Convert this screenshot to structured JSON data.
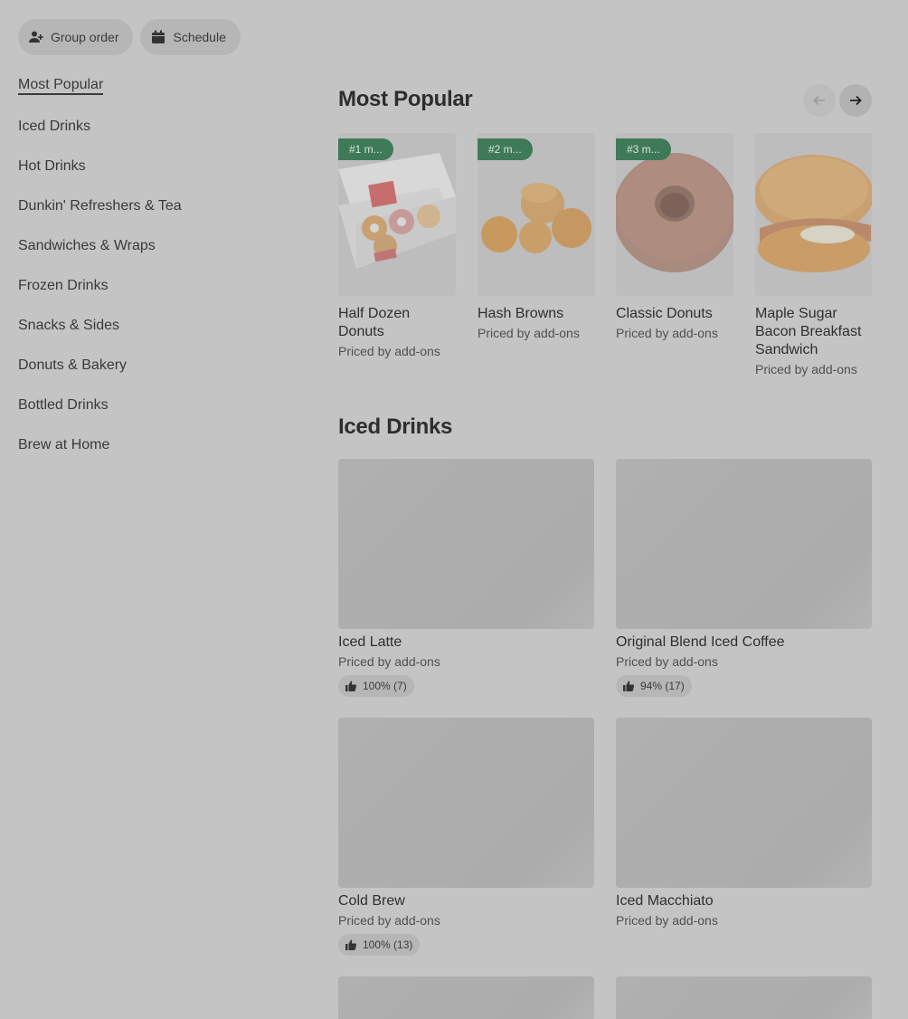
{
  "toolbar": {
    "group_order": "Group order",
    "schedule": "Schedule"
  },
  "sidebar": {
    "items": [
      {
        "label": "Most Popular",
        "active": true
      },
      {
        "label": "Iced Drinks"
      },
      {
        "label": "Hot Drinks"
      },
      {
        "label": "Dunkin' Refreshers & Tea"
      },
      {
        "label": "Sandwiches & Wraps"
      },
      {
        "label": "Frozen Drinks"
      },
      {
        "label": "Snacks & Sides"
      },
      {
        "label": "Donuts & Bakery"
      },
      {
        "label": "Bottled Drinks"
      },
      {
        "label": "Brew at Home"
      }
    ]
  },
  "most_popular": {
    "title": "Most Popular",
    "items": [
      {
        "rank": "#1 m...",
        "name": "Half Dozen Donuts",
        "price": "Priced by add-ons"
      },
      {
        "rank": "#2 m...",
        "name": "Hash Browns",
        "price": "Priced by add-ons"
      },
      {
        "rank": "#3 m...",
        "name": "Classic Donuts",
        "price": "Priced by add-ons"
      },
      {
        "rank": "",
        "name": "Maple Sugar Bacon Breakfast Sandwich",
        "price": "Priced by add-ons"
      }
    ]
  },
  "iced_drinks": {
    "title": "Iced Drinks",
    "items": [
      {
        "name": "Iced Latte",
        "price": "Priced by add-ons",
        "rating": "100% (7)"
      },
      {
        "name": "Original Blend Iced Coffee",
        "price": "Priced by add-ons",
        "rating": "94% (17)"
      },
      {
        "name": "Cold Brew",
        "price": "Priced by add-ons",
        "rating": "100% (13)"
      },
      {
        "name": "Iced Macchiato",
        "price": "Priced by add-ons"
      }
    ]
  },
  "colors": {
    "badge": "#3e7a58",
    "overlay_bg": "#c4c4c4"
  },
  "icons": {
    "group_order": "person-add-icon",
    "schedule": "calendar-icon",
    "prev": "arrow-left-icon",
    "next": "arrow-right-icon",
    "rating": "thumbs-up-icon"
  }
}
